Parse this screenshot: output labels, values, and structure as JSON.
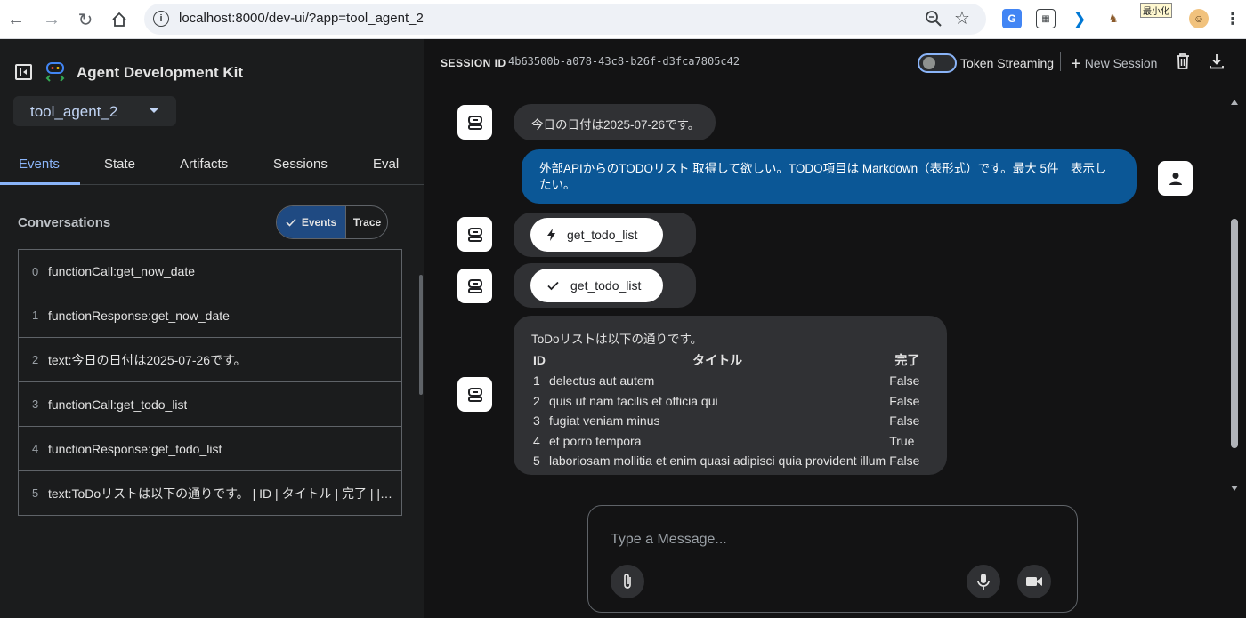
{
  "browser": {
    "url": "localhost:8000/dev-ui/?app=tool_agent_2",
    "ext_badge": "最小化"
  },
  "sidebar": {
    "title": "Agent Development Kit",
    "selected_app": "tool_agent_2",
    "tabs": [
      "Events",
      "State",
      "Artifacts",
      "Sessions",
      "Eval"
    ],
    "conversations_label": "Conversations",
    "toggle": {
      "on": "Events",
      "off": "Trace"
    },
    "events": [
      {
        "index": "0",
        "text": "functionCall:get_now_date"
      },
      {
        "index": "1",
        "text": "functionResponse:get_now_date"
      },
      {
        "index": "2",
        "text": "text:今日の日付は2025-07-26です。"
      },
      {
        "index": "3",
        "text": "functionCall:get_todo_list"
      },
      {
        "index": "4",
        "text": "functionResponse:get_todo_list"
      },
      {
        "index": "5",
        "text": "text:ToDoリストは以下の通りです。 | ID | タイトル | 完了 | | --- | --- | --- |"
      }
    ]
  },
  "session": {
    "label": "SESSION ID",
    "id": "4b63500b-a078-43c8-b26f-d3fca7805c42",
    "token_streaming_label": "Token Streaming",
    "new_session_label": "New Session"
  },
  "chat": {
    "msg1": "今日の日付は2025-07-26です。",
    "msg2": "外部APIからのTODOリスト 取得して欲しい。TODO項目は Markdown（表形式）です。最大 5件　表示したい。",
    "call_chip": "get_todo_list",
    "response_chip": "get_todo_list",
    "todo_intro": "ToDoリストは以下の通りです。",
    "todo_headers": [
      "ID",
      "タイトル",
      "完了"
    ],
    "todo_rows": [
      [
        "1",
        "delectus aut autem",
        "False"
      ],
      [
        "2",
        "quis ut nam facilis et officia qui",
        "False"
      ],
      [
        "3",
        "fugiat veniam minus",
        "False"
      ],
      [
        "4",
        "et porro tempora",
        "True"
      ],
      [
        "5",
        "laboriosam mollitia et enim quasi adipisci quia provident illum",
        "False"
      ]
    ]
  },
  "composer": {
    "placeholder": "Type a Message..."
  },
  "icons": {
    "back": "arrow-left-icon",
    "forward": "arrow-right-icon",
    "reload": "reload-icon",
    "home": "home-icon",
    "bot": "robot-icon",
    "user": "person-icon",
    "call": "bolt-icon",
    "response": "check-icon",
    "attach": "paperclip-icon",
    "mic": "microphone-icon",
    "camera": "video-camera-icon"
  },
  "colors": {
    "accent": "#8ab4f8",
    "user_bubble": "#0b5796",
    "bot_bubble": "#303134",
    "background": "#131314"
  }
}
